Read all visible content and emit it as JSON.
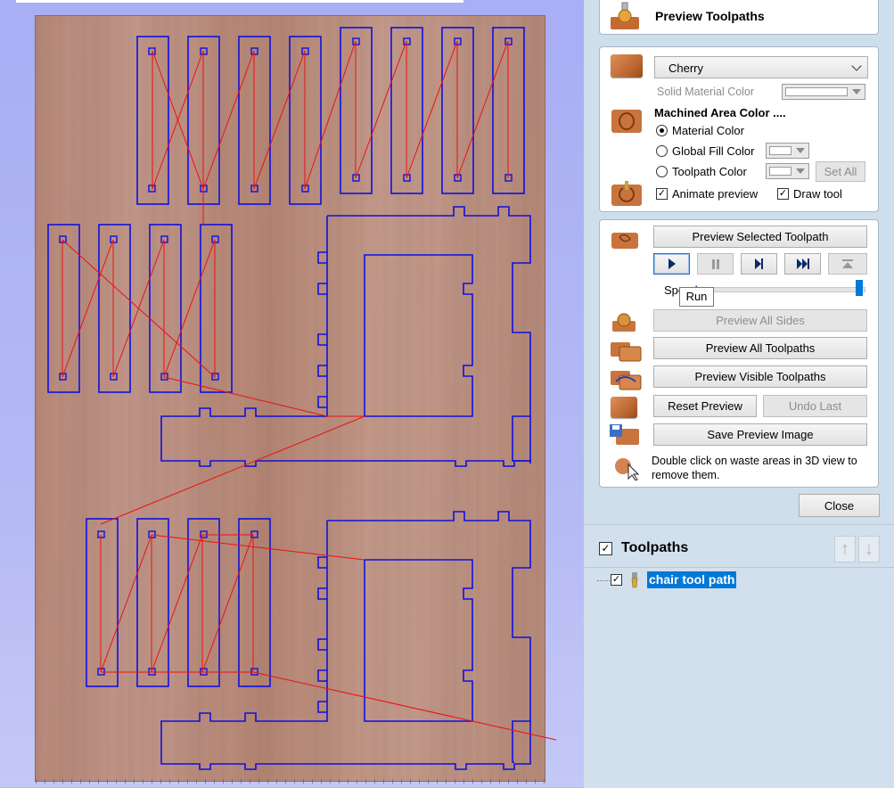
{
  "header": {
    "title": "Preview Toolpaths"
  },
  "material": {
    "selected": "Cherry",
    "solid_label": "Solid Material Color",
    "machined_heading": "Machined Area Color ....",
    "options": [
      "Material Color",
      "Global Fill Color",
      "Toolpath Color"
    ],
    "set_all": "Set All",
    "animate_label": "Animate preview",
    "draw_tool_label": "Draw tool"
  },
  "preview": {
    "selected_btn": "Preview Selected Toolpath",
    "speed_label": "Speed",
    "tooltip": "Run",
    "speed_level": 1.0,
    "all_sides_btn": "Preview All Sides",
    "all_toolpaths_btn": "Preview All Toolpaths",
    "visible_btn": "Preview Visible Toolpaths",
    "reset_btn": "Reset Preview",
    "undo_btn": "Undo Last",
    "save_btn": "Save Preview Image",
    "hint": "Double click on waste areas in 3D view to remove them."
  },
  "close_btn": "Close",
  "toolpaths": {
    "title": "Toolpaths",
    "items": [
      {
        "name": "chair tool path"
      }
    ]
  },
  "colors": {
    "contour": "#1010e0",
    "rapid": "#ee1010",
    "selection": "#0078d7",
    "panel": "#cfdeeb"
  }
}
